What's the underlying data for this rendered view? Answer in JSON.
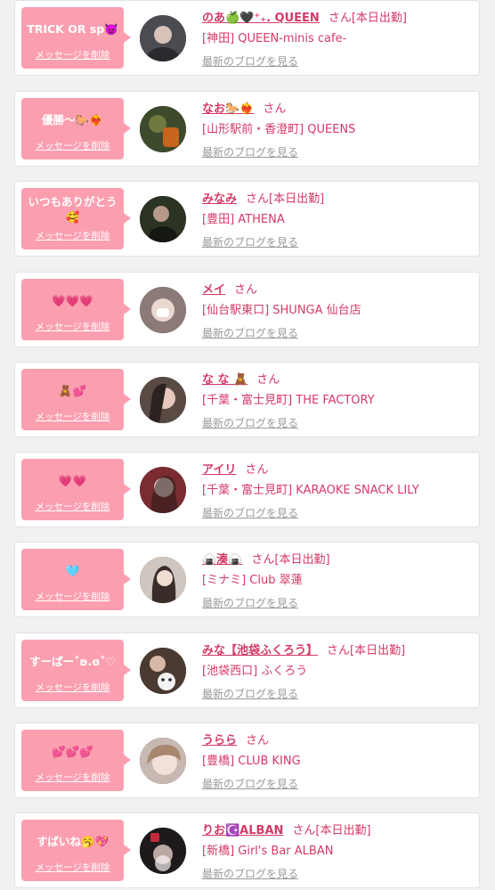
{
  "cards": [
    {
      "message": "TRICK OR sp👿",
      "delete_label": "メッセージを削除",
      "name": "のあ🍏🖤⁺₊. QUEEN",
      "honorific": "さん",
      "working": "[本日出勤]",
      "shop": "[神田] QUEEN-minis cafe-",
      "blog_link": "最新のブログを見る",
      "avatar_color": "#4a4c52"
    },
    {
      "message": "優勝〜🐎❤️‍🔥",
      "delete_label": "メッセージを削除",
      "name": "なお🐎❤️‍🔥",
      "honorific": "さん",
      "working": "",
      "shop": "[山形駅前・香澄町] QUEENS",
      "blog_link": "最新のブログを見る",
      "avatar_color": "#3d4a2c"
    },
    {
      "message": "いつもありがとう🥰",
      "delete_label": "メッセージを削除",
      "name": "みなみ",
      "honorific": "さん",
      "working": "[本日出勤]",
      "shop": "[豊田] ATHENA",
      "blog_link": "最新のブログを見る",
      "avatar_color": "#2b3323"
    },
    {
      "message": "💗💗💗",
      "delete_label": "メッセージを削除",
      "name": "メイ",
      "honorific": "さん",
      "working": "",
      "shop": "[仙台駅東口] SHUNGA 仙台店",
      "blog_link": "最新のブログを見る",
      "avatar_color": "#8b7a78"
    },
    {
      "message": "🧸💕",
      "delete_label": "メッセージを削除",
      "name": "な な 🧸",
      "honorific": "さん",
      "working": "",
      "shop": "[千葉・富士見町] THE FACTORY",
      "blog_link": "最新のブログを見る",
      "avatar_color": "#5a4a44"
    },
    {
      "message": "💗💗",
      "delete_label": "メッセージを削除",
      "name": "アイリ",
      "honorific": "さん",
      "working": "",
      "shop": "[千葉・富士見町] KARAOKE SNACK LILY",
      "blog_link": "最新のブログを見る",
      "avatar_color": "#7a2c30"
    },
    {
      "message": "🩵",
      "delete_label": "メッセージを削除",
      "name": "🍙湊🍙",
      "honorific": "さん",
      "working": "[本日出勤]",
      "shop": "[ミナミ] Club 翠蓮",
      "blog_link": "最新のブログを見る",
      "avatar_color": "#cfc6bf"
    },
    {
      "message": "すーぱー˚ʚ.ɞ˚♡",
      "delete_label": "メッセージを削除",
      "name": "みな【池袋ふくろう】",
      "honorific": "さん",
      "working": "[本日出勤]",
      "shop": "[池袋西口] ふくろう",
      "blog_link": "最新のブログを見る",
      "avatar_color": "#4a3a32"
    },
    {
      "message": "💕💕💕",
      "delete_label": "メッセージを削除",
      "name": "うらら",
      "honorific": "さん",
      "working": "",
      "shop": "[豊橋] CLUB KING",
      "blog_link": "最新のブログを見る",
      "avatar_color": "#c8b8b2"
    },
    {
      "message": "すばいね🥱💖",
      "delete_label": "メッセージを削除",
      "name": "りお☪️ALBAN",
      "honorific": "さん",
      "working": "[本日出勤]",
      "shop": "[新橋] Girl's Bar ALBAN",
      "blog_link": "最新のブログを見る",
      "avatar_color": "#1e1a1c"
    }
  ]
}
